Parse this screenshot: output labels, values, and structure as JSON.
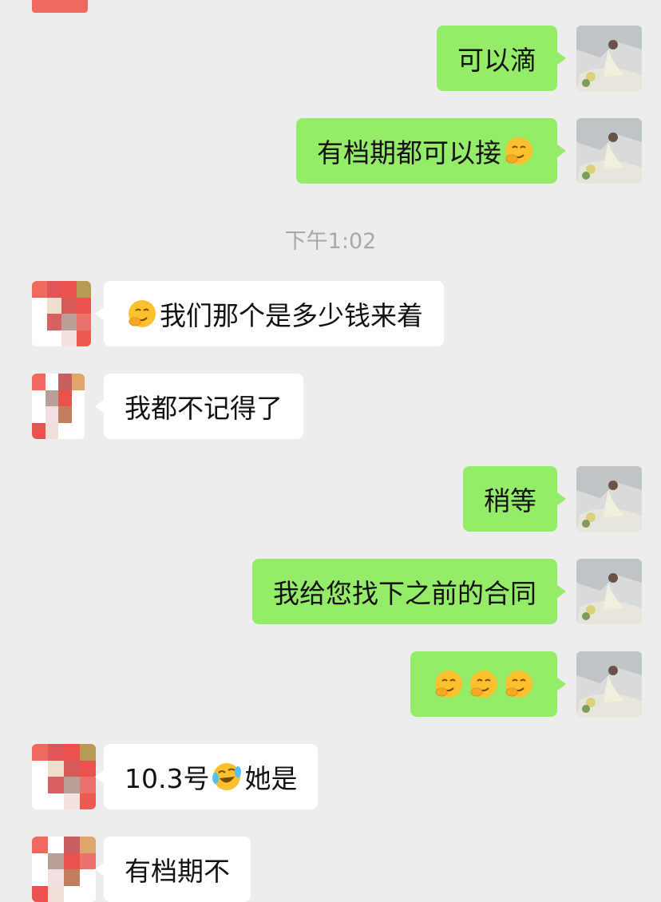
{
  "colors": {
    "background": "#EDEDED",
    "mine_bubble": "#95EC69",
    "their_bubble": "#FFFFFF",
    "timestamp": "#A8A8A8"
  },
  "messages": [
    {
      "from": "me",
      "text": "可以滴"
    },
    {
      "from": "me",
      "text": "有档期都可以接",
      "trailing_emoji": "thinking-smirk-emoji"
    },
    {
      "type": "timestamp",
      "text": "下午1:02"
    },
    {
      "from": "them",
      "leading_emoji": "thinking-smirk-emoji",
      "text": "我们那个是多少钱来着"
    },
    {
      "from": "them",
      "text": "我都不记得了"
    },
    {
      "from": "me",
      "text": "稍等"
    },
    {
      "from": "me",
      "text": "我给您找下之前的合同"
    },
    {
      "from": "me",
      "emojis": [
        "thinking-smirk-emoji",
        "thinking-smirk-emoji",
        "thinking-smirk-emoji"
      ]
    },
    {
      "from": "them",
      "text_before": "10.3号",
      "emoji": "laughing-crying-emoji",
      "text_after": "她是"
    },
    {
      "from": "them",
      "text": "有档期不"
    }
  ]
}
